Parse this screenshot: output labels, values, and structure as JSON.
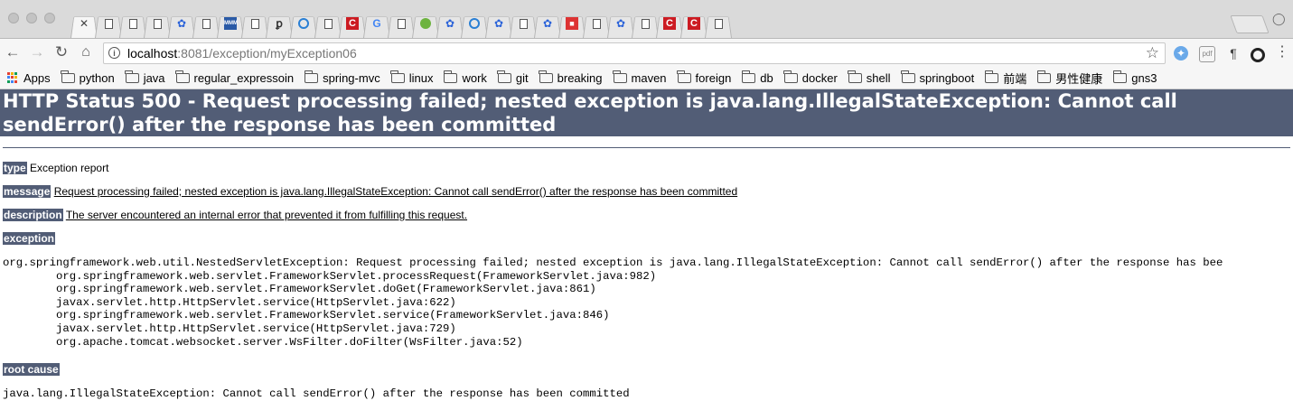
{
  "browser": {
    "address": {
      "host": "localhost",
      "rest": ":8081/exception/myException06"
    },
    "bookmarks": [
      "python",
      "java",
      "regular_expressoin",
      "spring-mvc",
      "linux",
      "work",
      "git",
      "breaking",
      "maven",
      "foreign",
      "db",
      "docker",
      "shell",
      "springboot",
      "前端",
      "男性健康",
      "gns3"
    ],
    "apps_label": "Apps",
    "tab_icons": [
      "close-icon",
      "document-icon",
      "document-icon",
      "document-icon",
      "baidu-paw-icon",
      "document-icon",
      "mmm-logo-icon",
      "document-icon",
      "swirl-icon",
      "edge-e-icon",
      "document-icon",
      "red-c-icon",
      "google-g-icon",
      "document-icon",
      "spring-leaf-icon",
      "baidu-paw-icon",
      "edge-e-icon",
      "baidu-paw-icon",
      "document-icon",
      "baidu-paw-icon",
      "red-box-icon",
      "document-icon",
      "baidu-paw-icon",
      "document-icon",
      "red-c-icon",
      "red-c-icon",
      "document-icon"
    ]
  },
  "error_page": {
    "heading": "HTTP Status 500 - Request processing failed; nested exception is java.lang.IllegalStateException: Cannot call sendError() after the response has been committed",
    "type_label": "type",
    "type_value": "Exception report",
    "message_label": "message",
    "message_value": "Request processing failed; nested exception is java.lang.IllegalStateException: Cannot call sendError() after the response has been committed",
    "description_label": "description",
    "description_value": "The server encountered an internal error that prevented it from fulfilling this request.",
    "exception_label": "exception",
    "exception_trace": "org.springframework.web.util.NestedServletException: Request processing failed; nested exception is java.lang.IllegalStateException: Cannot call sendError() after the response has bee\n\torg.springframework.web.servlet.FrameworkServlet.processRequest(FrameworkServlet.java:982)\n\torg.springframework.web.servlet.FrameworkServlet.doGet(FrameworkServlet.java:861)\n\tjavax.servlet.http.HttpServlet.service(HttpServlet.java:622)\n\torg.springframework.web.servlet.FrameworkServlet.service(FrameworkServlet.java:846)\n\tjavax.servlet.http.HttpServlet.service(HttpServlet.java:729)\n\torg.apache.tomcat.websocket.server.WsFilter.doFilter(WsFilter.java:52)",
    "root_cause_label": "root cause",
    "root_cause_trace": "java.lang.IllegalStateException: Cannot call sendError() after the response has been committed"
  }
}
